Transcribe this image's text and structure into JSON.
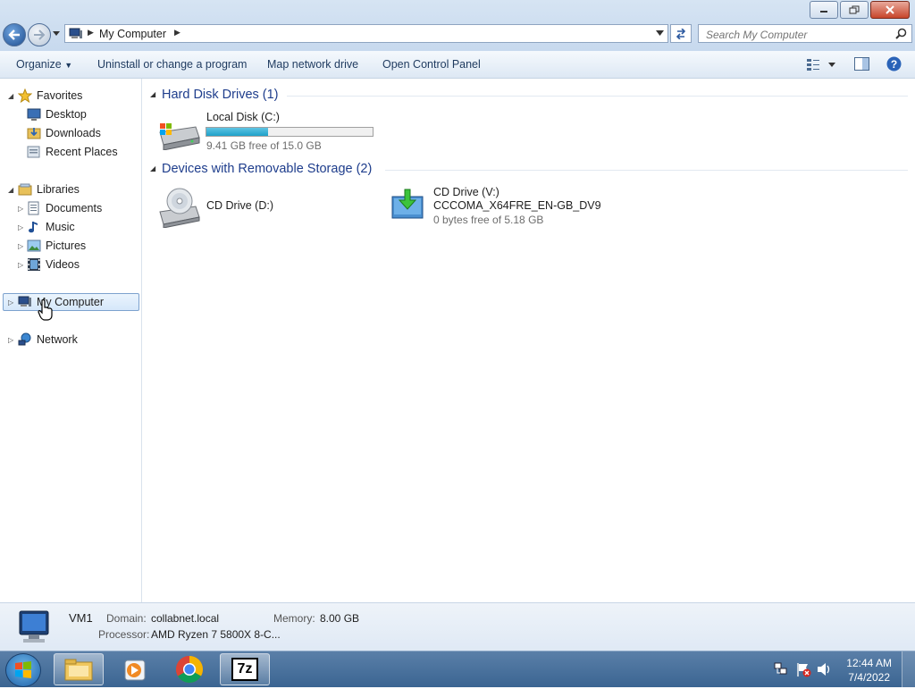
{
  "window": {
    "address": {
      "segments": [
        "My Computer"
      ]
    },
    "search": {
      "placeholder": "Search My Computer"
    }
  },
  "toolbar": {
    "organize": "Organize",
    "uninstall": "Uninstall or change a program",
    "map_drive": "Map network drive",
    "control_panel": "Open Control Panel"
  },
  "nav": {
    "favorites": {
      "label": "Favorites",
      "items": [
        "Desktop",
        "Downloads",
        "Recent Places"
      ]
    },
    "libraries": {
      "label": "Libraries",
      "items": [
        "Documents",
        "Music",
        "Pictures",
        "Videos"
      ]
    },
    "computer": "My Computer",
    "network": "Network"
  },
  "groups": [
    {
      "header": "Hard Disk Drives (1)",
      "drives": [
        {
          "name": "Local Disk (C:)",
          "free_text": "9.41 GB free of 15.0 GB",
          "used_fraction": 0.37
        }
      ]
    },
    {
      "header": "Devices with Removable Storage (2)",
      "drives": [
        {
          "name": "CD Drive (D:)"
        },
        {
          "name": "CD Drive (V:)",
          "label": "CCCOMA_X64FRE_EN-GB_DV9",
          "free_text": "0 bytes free of 5.18 GB"
        }
      ]
    }
  ],
  "details": {
    "name": "VM1",
    "domain_label": "Domain:",
    "domain": "collabnet.local",
    "memory_label": "Memory:",
    "memory": "8.00 GB",
    "processor_label": "Processor:",
    "processor": "AMD Ryzen 7 5800X 8-C..."
  },
  "taskbar": {
    "time": "12:44 AM",
    "date": "7/4/2022",
    "apps": [
      "windows-explorer",
      "media-player",
      "chrome",
      "7zip"
    ],
    "sevenzip_text": "7z"
  },
  "colors": {
    "accent": "#1e3d8c",
    "capacity_fill": "#1ea1c9",
    "taskbar": "#3b6592"
  }
}
